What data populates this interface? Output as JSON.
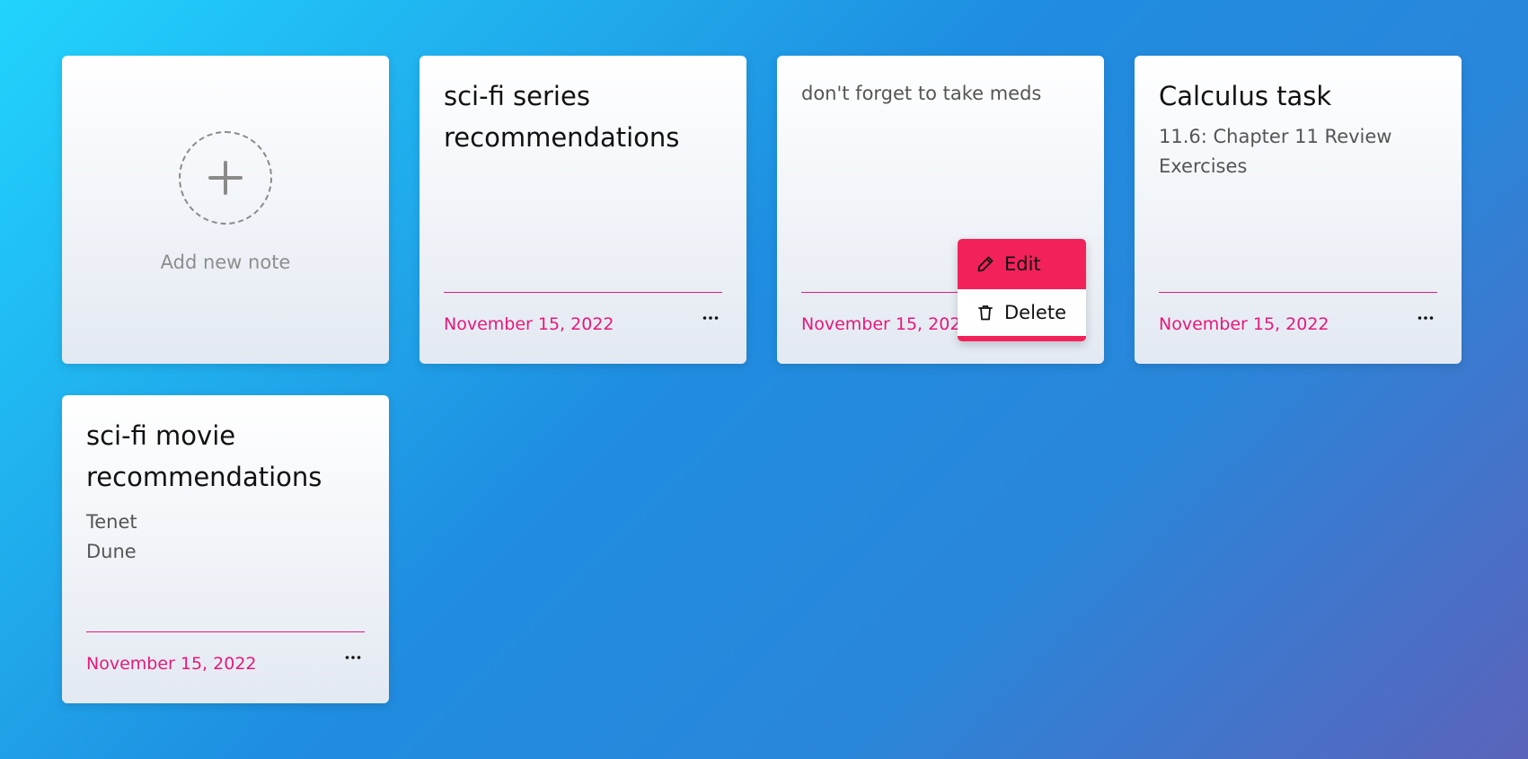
{
  "add_card": {
    "label": "Add new note",
    "icon": "plus-icon"
  },
  "notes": [
    {
      "title": "sci-fi series recommendations",
      "body": "",
      "date": "November 15, 2022"
    },
    {
      "title": "",
      "body": "don't forget to take meds",
      "date": "November 15, 2022",
      "menu_open": true
    },
    {
      "title": "Calculus task",
      "body": "11.6: Chapter 11 Review Exercises",
      "date": "November 15, 2022"
    },
    {
      "title": "sci-fi movie recommendations",
      "body": "Tenet\nDune",
      "date": "November 15, 2022"
    }
  ],
  "context_menu": {
    "edit_label": "Edit",
    "delete_label": "Delete",
    "edit_icon": "pencil-icon",
    "delete_icon": "trash-icon"
  },
  "colors": {
    "accent": "#e6197a",
    "menu_highlight": "#f2215a",
    "background_start": "#21d4fd",
    "background_end": "#5b63bb"
  }
}
